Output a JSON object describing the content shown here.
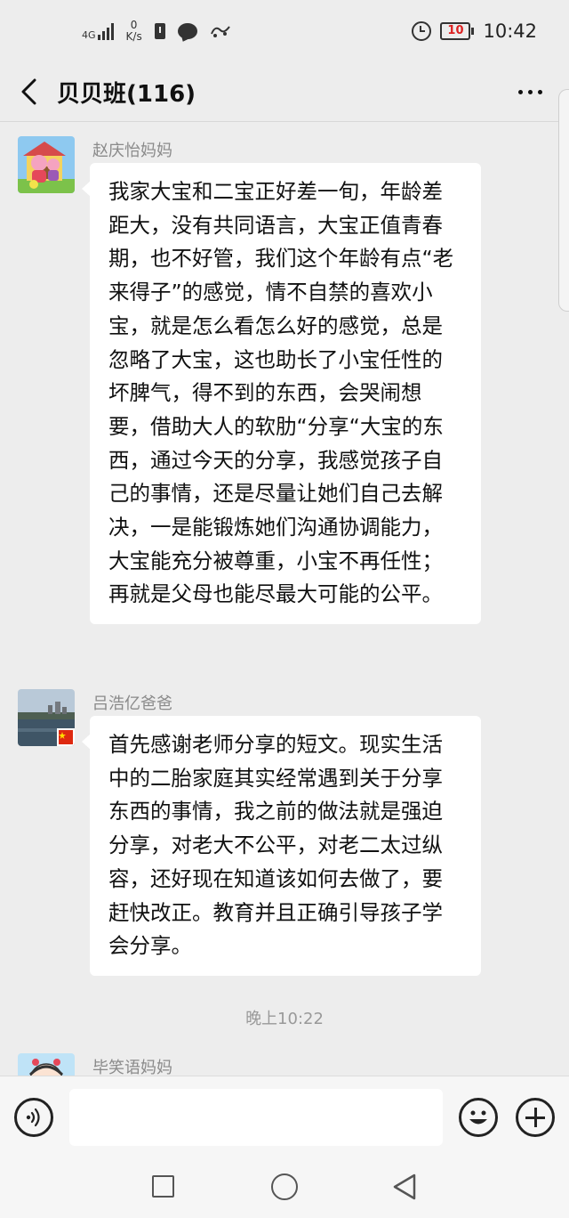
{
  "status_bar": {
    "network": "4G",
    "speed_value": "0",
    "speed_unit": "K/s",
    "battery": "10",
    "time": "10:42"
  },
  "nav": {
    "title": "贝贝班(116)"
  },
  "messages": [
    {
      "sender": "赵庆怡妈妈",
      "text": "我家大宝和二宝正好差一旬，年龄差距大，没有共同语言，大宝正值青春期，也不好管，我们这个年龄有点“老来得子”的感觉，情不自禁的喜欢小宝，就是怎么看怎么好的感觉，总是忽略了大宝，这也助长了小宝任性的坏脾气，得不到的东西，会哭闹想要，借助大人的软肋“分享“大宝的东西，通过今天的分享，我感觉孩子自己的事情，还是尽量让她们自己去解决，一是能锻炼她们沟通协调能力，大宝能充分被尊重，小宝不再任性；再就是父母也能尽最大可能的公平。"
    },
    {
      "sender": "吕浩亿爸爸",
      "text": "首先感谢老师分享的短文。现实生活中的二胎家庭其实经常遇到关于分享东西的事情，我之前的做法就是强迫分享，对老大不公平，对老二太过纵容，还好现在知道该如何去做了，要赶快改正。教育并且正确引导孩子学会分享。"
    },
    {
      "sender": "毕笑语妈妈",
      "text": ""
    }
  ],
  "timestamp": "晚上10:22",
  "input": {
    "value": "",
    "placeholder": ""
  },
  "colors": {
    "background": "#ededed",
    "bubble": "#ffffff",
    "sender_name": "#8a8a8a",
    "battery_low": "#dd2222"
  }
}
